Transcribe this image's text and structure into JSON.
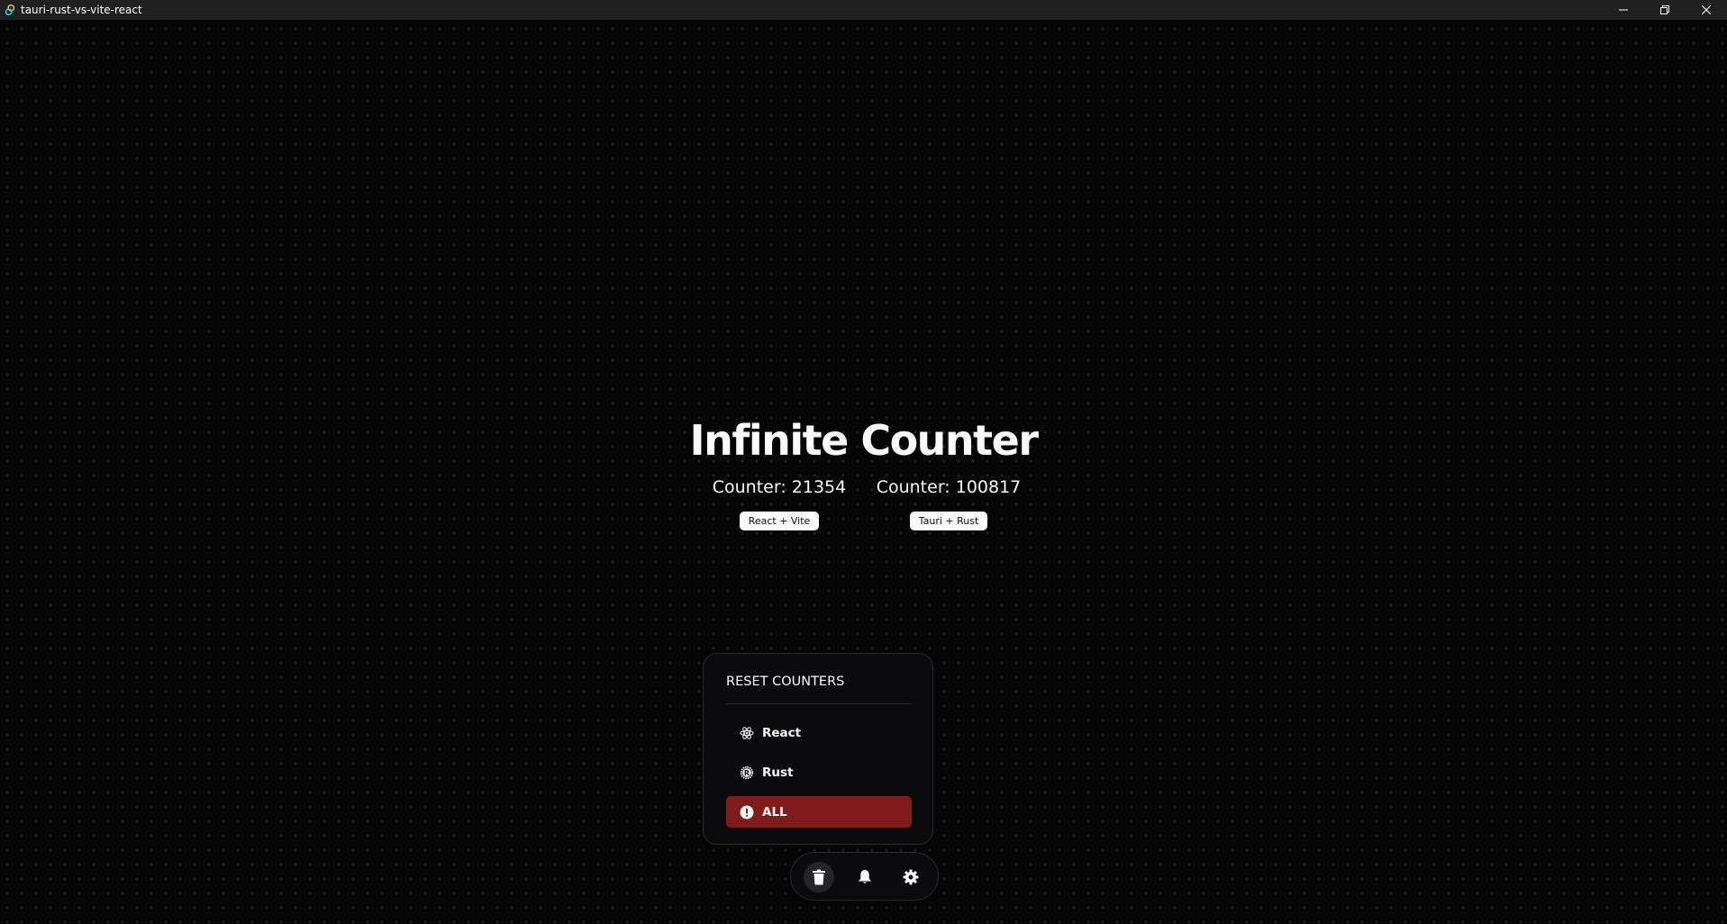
{
  "window": {
    "title": "tauri-rust-vs-vite-react",
    "controls": [
      "minimize",
      "restore",
      "close"
    ]
  },
  "main": {
    "heading": "Infinite Counter",
    "counters": [
      {
        "label": "Counter: 21354",
        "value": 21354,
        "button_label": "React + Vite"
      },
      {
        "label": "Counter: 100817",
        "value": 100817,
        "button_label": "Tauri + Rust"
      }
    ]
  },
  "reset_panel": {
    "title": "RESET COUNTERS",
    "items": [
      {
        "label": "React",
        "icon": "react-icon"
      },
      {
        "label": "Rust",
        "icon": "rust-icon"
      },
      {
        "label": "ALL",
        "icon": "alert-icon",
        "variant": "danger"
      }
    ]
  },
  "dock": {
    "items": [
      {
        "icon": "trash-icon",
        "active": true
      },
      {
        "icon": "bell-icon",
        "active": false
      },
      {
        "icon": "gear-icon",
        "active": false
      }
    ]
  },
  "colors": {
    "background": "#050505",
    "danger": "#7f1d1d",
    "panel": "#0b0b0d",
    "text": "#fafafa"
  }
}
